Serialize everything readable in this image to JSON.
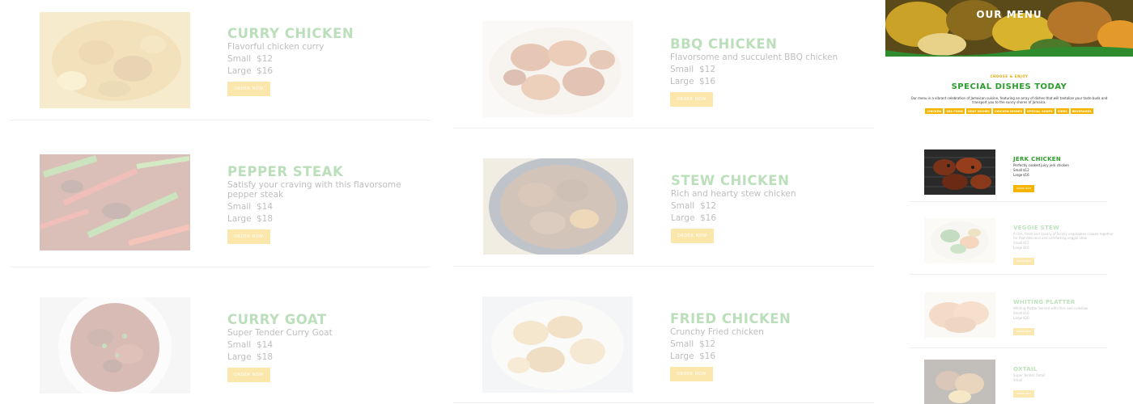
{
  "zoomed_menu": {
    "items": [
      {
        "name": "CURRY CHICKEN",
        "desc": "Flavorful chicken curry",
        "small_label": "Small",
        "small_price": "$12",
        "large_label": "Large",
        "large_price": "$16",
        "button": "ORDER NOW"
      },
      {
        "name": "BBQ CHICKEN",
        "desc": "Flavorsome and succulent BBQ chicken",
        "small_label": "Small",
        "small_price": "$12",
        "large_label": "Large",
        "large_price": "$16",
        "button": "ORDER NOW"
      },
      {
        "name": "PEPPER STEAK",
        "desc": "Satisfy your craving with this flavorsome pepper steak",
        "small_label": "Small",
        "small_price": "$14",
        "large_label": "Large",
        "large_price": "$18",
        "button": "ORDER NOW"
      },
      {
        "name": "STEW CHICKEN",
        "desc": "Rich and hearty stew chicken",
        "small_label": "Small",
        "small_price": "$12",
        "large_label": "Large",
        "large_price": "$16",
        "button": "ORDER NOW"
      },
      {
        "name": "CURRY GOAT",
        "desc": "Super Tender Curry Goat",
        "small_label": "Small",
        "small_price": "$14",
        "large_label": "Large",
        "large_price": "$18",
        "button": "ORDER NOW"
      },
      {
        "name": "FRIED CHICKEN",
        "desc": "Crunchy Fried chicken",
        "small_label": "Small",
        "small_price": "$12",
        "large_label": "Large",
        "large_price": "$16",
        "button": "ORDER NOW"
      }
    ]
  },
  "page": {
    "hero_title": "OUR MENU",
    "kicker": "CHOOSE & ENJOY",
    "special_title": "SPECIAL DISHES TODAY",
    "intro": "Our menu is a vibrant celebration of Jamaican cuisine, featuring an array of dishes that will tantalize your taste buds and transport you to the sunny shores of Jamaica.",
    "categories": [
      "CHICKEN",
      "SEA FOOD",
      "GOAT DISHES",
      "CHICKEN DISHES",
      "SPECIAL SOUPS",
      "SIDES",
      "BEVERAGES"
    ],
    "items": [
      {
        "name": "JERK CHICKEN",
        "desc": "Perfectly cooked juicy jerk chicken",
        "small_label": "Small",
        "small_price": "$12",
        "large_label": "Large",
        "large_price": "$16",
        "button": "ORDER NOW"
      },
      {
        "name": "VEGGIE STEW",
        "desc": "A rich, fresh and savory of locally vegetables cooked together for that delicious and comforting veggie stew",
        "small_label": "Small",
        "small_price": "$12",
        "large_label": "Large",
        "large_price": "$16",
        "button": "ORDER NOW"
      },
      {
        "name": "WHITING PLATTER",
        "desc": "Whiting Platter Served with fries and coleslaw",
        "small_label": "Small",
        "small_price": "$16",
        "large_label": "Large",
        "large_price": "$20",
        "button": "ORDER NOW"
      },
      {
        "name": "OXTAIL",
        "desc": "Super Tender Oxtail",
        "small_label": "Small",
        "small_price": "",
        "large_label": "",
        "large_price": "",
        "button": "ORDER NOW"
      }
    ]
  }
}
